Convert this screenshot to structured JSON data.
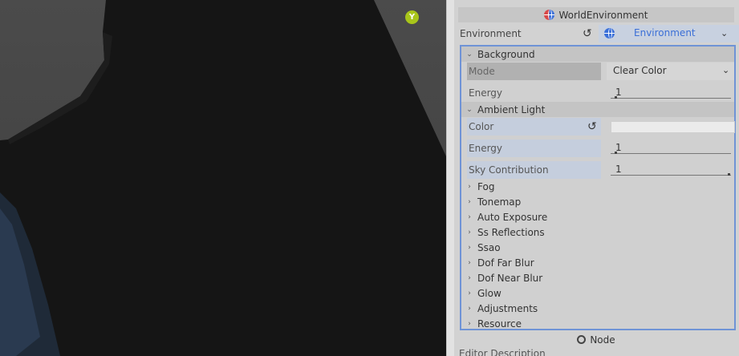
{
  "viewport": {
    "gizmo_label": "Y"
  },
  "inspector": {
    "node_title": "WorldEnvironment",
    "environment": {
      "label": "Environment",
      "value": "Environment"
    },
    "background": {
      "header": "Background",
      "mode": {
        "label": "Mode",
        "value": "Clear Color"
      },
      "energy": {
        "label": "Energy",
        "value": "1"
      }
    },
    "ambient_light": {
      "header": "Ambient Light",
      "color": {
        "label": "Color"
      },
      "energy": {
        "label": "Energy",
        "value": "1"
      },
      "sky_contribution": {
        "label": "Sky Contribution",
        "value": "1"
      }
    },
    "collapsed_sections": [
      "Fog",
      "Tonemap",
      "Auto Exposure",
      "Ss Reflections",
      "Ssao",
      "Dof Far Blur",
      "Dof Near Blur",
      "Glow",
      "Adjustments",
      "Resource"
    ],
    "bottom_node": "Node",
    "editor_description": "Editor Description"
  },
  "colors": {
    "accent": "#3b6fd6",
    "panel_border": "#6f93d6",
    "gizmo": "#a8c51a"
  }
}
